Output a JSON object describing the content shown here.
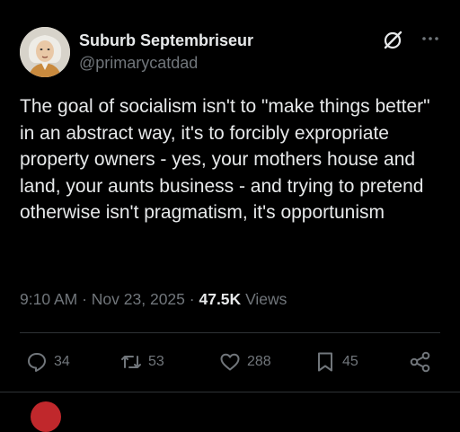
{
  "author": {
    "display_name": "Suburb Septembriseur",
    "handle": "@primarycatdad"
  },
  "tweet": {
    "text": "The goal of socialism isn't to \"make things better\" in an abstract way, it's to forcibly expropriate property owners - yes, your mothers house and land, your aunts business - and trying to pretend otherwise isn't pragmatism, it's opportunism"
  },
  "meta": {
    "time": "9:10 AM",
    "separator1": "·",
    "date": "Nov 23, 2025",
    "separator2": "·",
    "views_count": "47.5K",
    "views_label": "Views"
  },
  "actions": {
    "replies": "34",
    "reposts": "53",
    "likes": "288",
    "bookmarks": "45"
  },
  "icons": [
    "avatar-portrait",
    "grok-icon",
    "more-icon",
    "reply-icon",
    "repost-icon",
    "like-icon",
    "bookmark-icon",
    "share-icon"
  ],
  "colors": {
    "background": "#000000",
    "text": "#e7e9ea",
    "muted": "#71767b",
    "divider": "#2f3336"
  }
}
